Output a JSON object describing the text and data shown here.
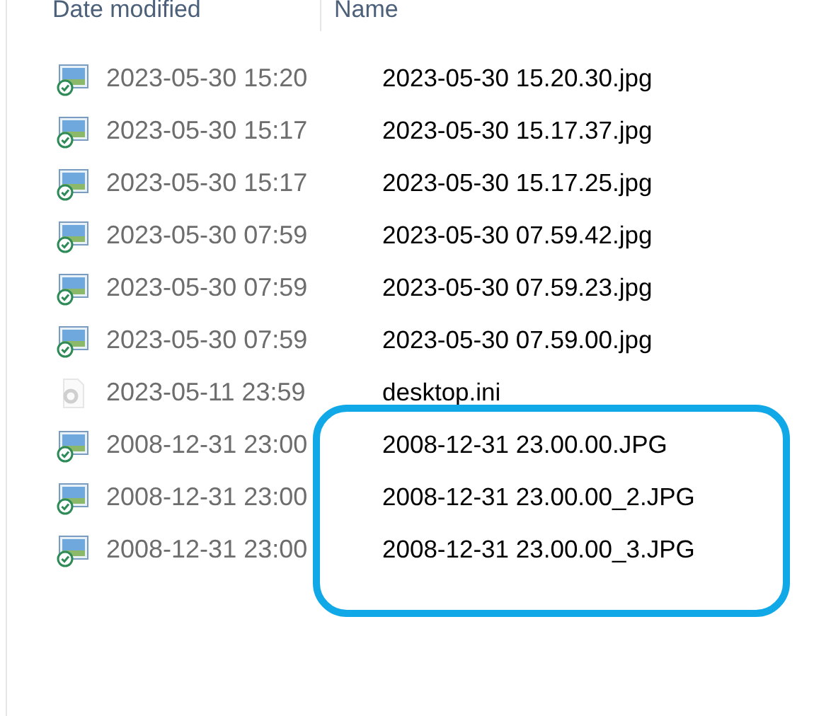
{
  "columns": [
    "Date modified",
    "Name"
  ],
  "rows": [
    {
      "kind": "image",
      "date": "2023-05-30 15:20",
      "name": "2023-05-30 15.20.30.jpg"
    },
    {
      "kind": "image",
      "date": "2023-05-30 15:17",
      "name": "2023-05-30 15.17.37.jpg"
    },
    {
      "kind": "image",
      "date": "2023-05-30 15:17",
      "name": "2023-05-30 15.17.25.jpg"
    },
    {
      "kind": "image",
      "date": "2023-05-30 07:59",
      "name": "2023-05-30 07.59.42.jpg"
    },
    {
      "kind": "image",
      "date": "2023-05-30 07:59",
      "name": "2023-05-30 07.59.23.jpg"
    },
    {
      "kind": "image",
      "date": "2023-05-30 07:59",
      "name": "2023-05-30 07.59.00.jpg"
    },
    {
      "kind": "settings",
      "date": "2023-05-11 23:59",
      "name": "desktop.ini"
    },
    {
      "kind": "image",
      "date": "2008-12-31 23:00",
      "name": "2008-12-31 23.00.00.JPG"
    },
    {
      "kind": "image",
      "date": "2008-12-31 23:00",
      "name": "2008-12-31 23.00.00_2.JPG"
    },
    {
      "kind": "image",
      "date": "2008-12-31 23:00",
      "name": "2008-12-31 23.00.00_3.JPG"
    }
  ]
}
